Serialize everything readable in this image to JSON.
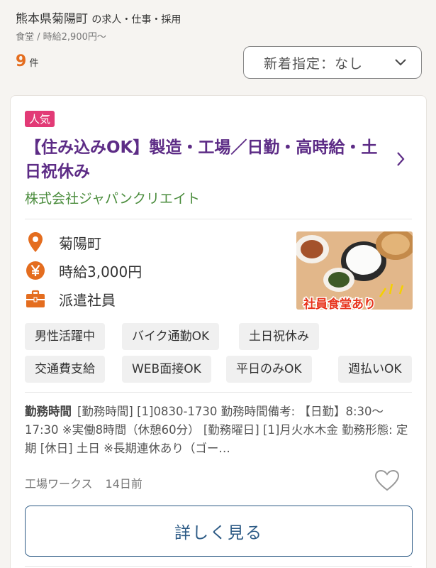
{
  "header": {
    "title": "熊本県菊陽町",
    "title_suffix": "の求人・仕事・採用",
    "subtitle": "食堂 / 時給2,900円〜"
  },
  "results": {
    "count": "9",
    "unit": "件"
  },
  "sort": {
    "label": "新着指定：なし",
    "icon": "chevron-down-icon"
  },
  "job": {
    "badge": "人気",
    "title": "【住み込みOK】製造・工場／日勤・高時給・土日祝休み",
    "company": "株式会社ジャパンクリエイト",
    "location": "菊陽町",
    "wage": "時給3,000円",
    "employment": "派遣社員",
    "image_caption": "社員食堂あり",
    "tags": [
      "男性活躍中",
      "バイク通勤OK",
      "土日祝休み",
      "交通費支給",
      "WEB面接OK",
      "平日のみOK",
      "週払いOK"
    ],
    "hours_label": "勤務時間",
    "hours_text": "[勤務時間] [1]0830-1730 勤務時間備考: 【日勤】8:30〜17:30 ※実働8時間（休憩60分） [勤務曜日] [1]月火水木金 勤務形態: 定期 [休日] 土日 ※長期連休あり（ゴー…",
    "source": "工場ワークス",
    "posted": "14日前",
    "detail_button": "詳しく見る"
  },
  "colors": {
    "accent_orange": "#e46d1f",
    "badge_pink": "#e23a76",
    "title_purple": "#5d2c86",
    "company_green": "#4a8c3c",
    "button_blue": "#2c5a85"
  }
}
